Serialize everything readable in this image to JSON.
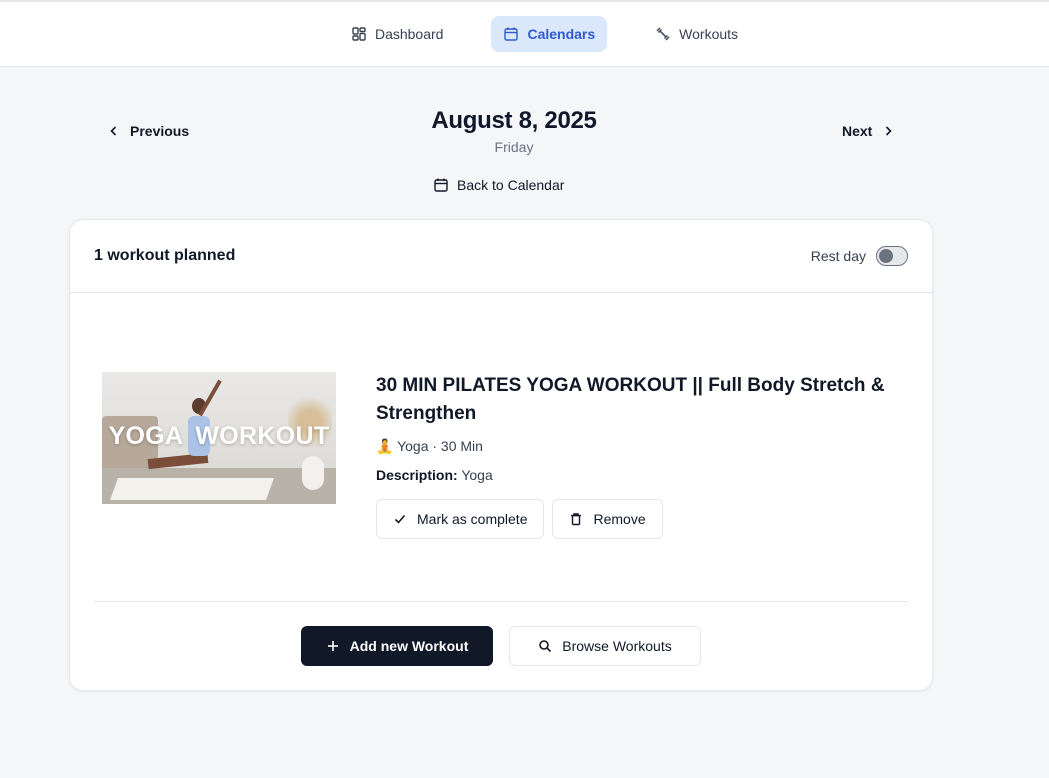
{
  "nav": {
    "items": [
      {
        "label": "Dashboard",
        "icon": "dashboard-icon",
        "active": false
      },
      {
        "label": "Calendars",
        "icon": "calendar-icon",
        "active": true
      },
      {
        "label": "Workouts",
        "icon": "dumbbell-icon",
        "active": false
      }
    ]
  },
  "date": {
    "previous_label": "Previous",
    "next_label": "Next",
    "title": "August 8, 2025",
    "weekday": "Friday",
    "back_label": "Back to Calendar"
  },
  "card": {
    "planned_label": "1 workout planned",
    "rest_day_label": "Rest day",
    "rest_day_on": false
  },
  "workout": {
    "thumbnail_text_left": "YOGA",
    "thumbnail_text_right": "WORKOUT",
    "title": "30 MIN PILATES YOGA WORKOUT || Full Body Stretch & Strengthen",
    "emoji": "🧘",
    "meta": "Yoga · 30 Min",
    "description_label": "Description:",
    "description": "Yoga",
    "complete_label": "Mark as complete",
    "remove_label": "Remove"
  },
  "footer": {
    "add_label": "Add new Workout",
    "browse_label": "Browse Workouts"
  },
  "colors": {
    "accent": "#2f5ad1",
    "active_bg": "#dbe7fb",
    "dark_button": "#111827"
  }
}
